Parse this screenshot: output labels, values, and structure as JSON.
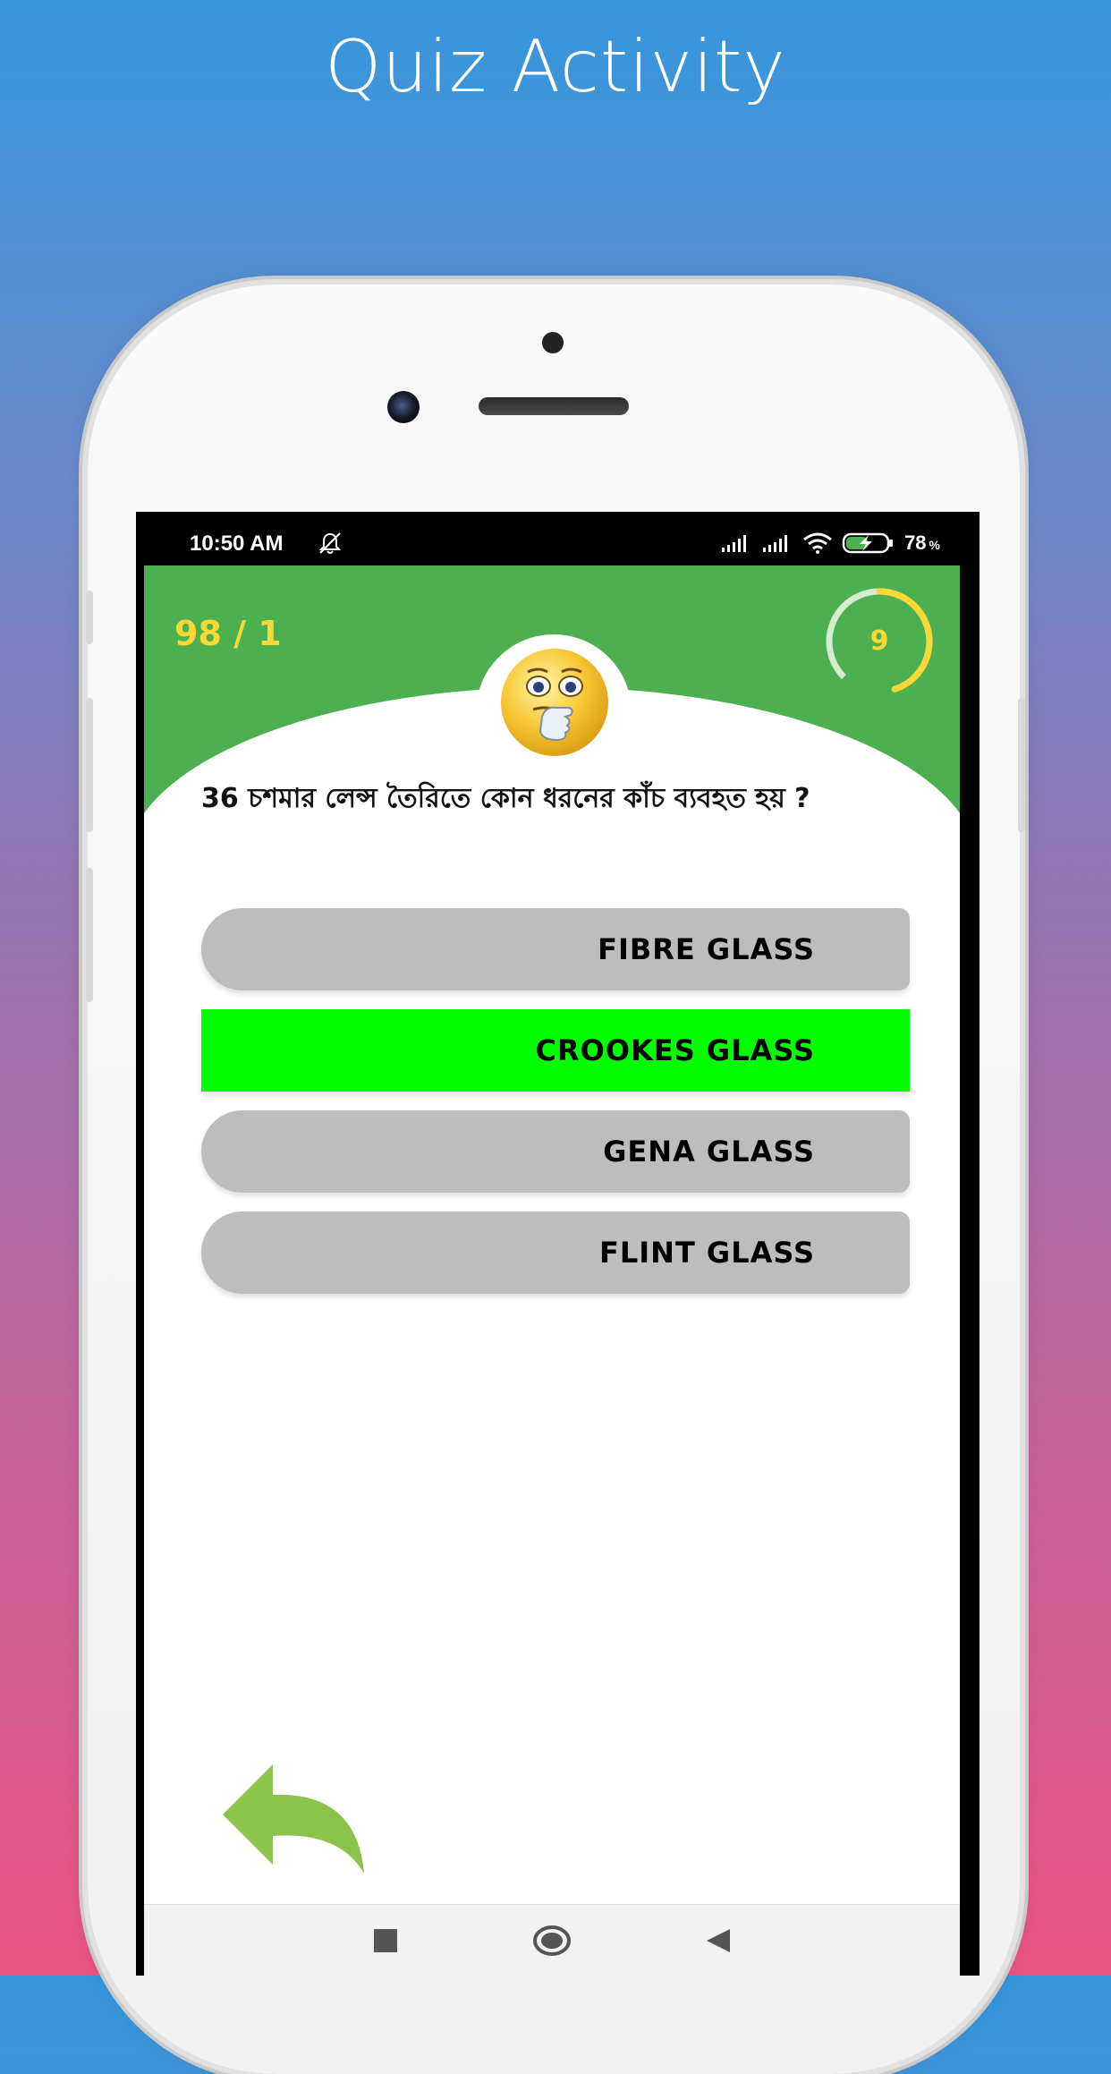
{
  "banner": {
    "title": "Quiz Activity"
  },
  "statusbar": {
    "time": "10:50 AM",
    "battery": "78",
    "battery_unit": "%"
  },
  "quiz": {
    "progress": "98 / 1",
    "timer": "9",
    "timer_fraction": 0.45,
    "question": "36 চশমার লেন্স তৈরিতে কোন ধরনের কাঁচ ব্যবহত হয় ?",
    "options": [
      {
        "label": "FIBRE GLASS",
        "state": "default"
      },
      {
        "label": "CROOKES GLASS",
        "state": "correct"
      },
      {
        "label": "GENA GLASS",
        "state": "default"
      },
      {
        "label": "FLINT GLASS",
        "state": "default"
      }
    ]
  },
  "colors": {
    "header_green": "#4caf50",
    "accent_yellow": "#fdd835",
    "correct_green": "#00ff00",
    "option_grey": "#bdbdbd",
    "back_arrow": "#8bc34a"
  },
  "icons": {
    "emoji": "thinking-emoji-icon",
    "back": "back-arrow-icon",
    "nav": [
      "recents-square-icon",
      "home-circle-icon",
      "back-triangle-icon"
    ]
  }
}
